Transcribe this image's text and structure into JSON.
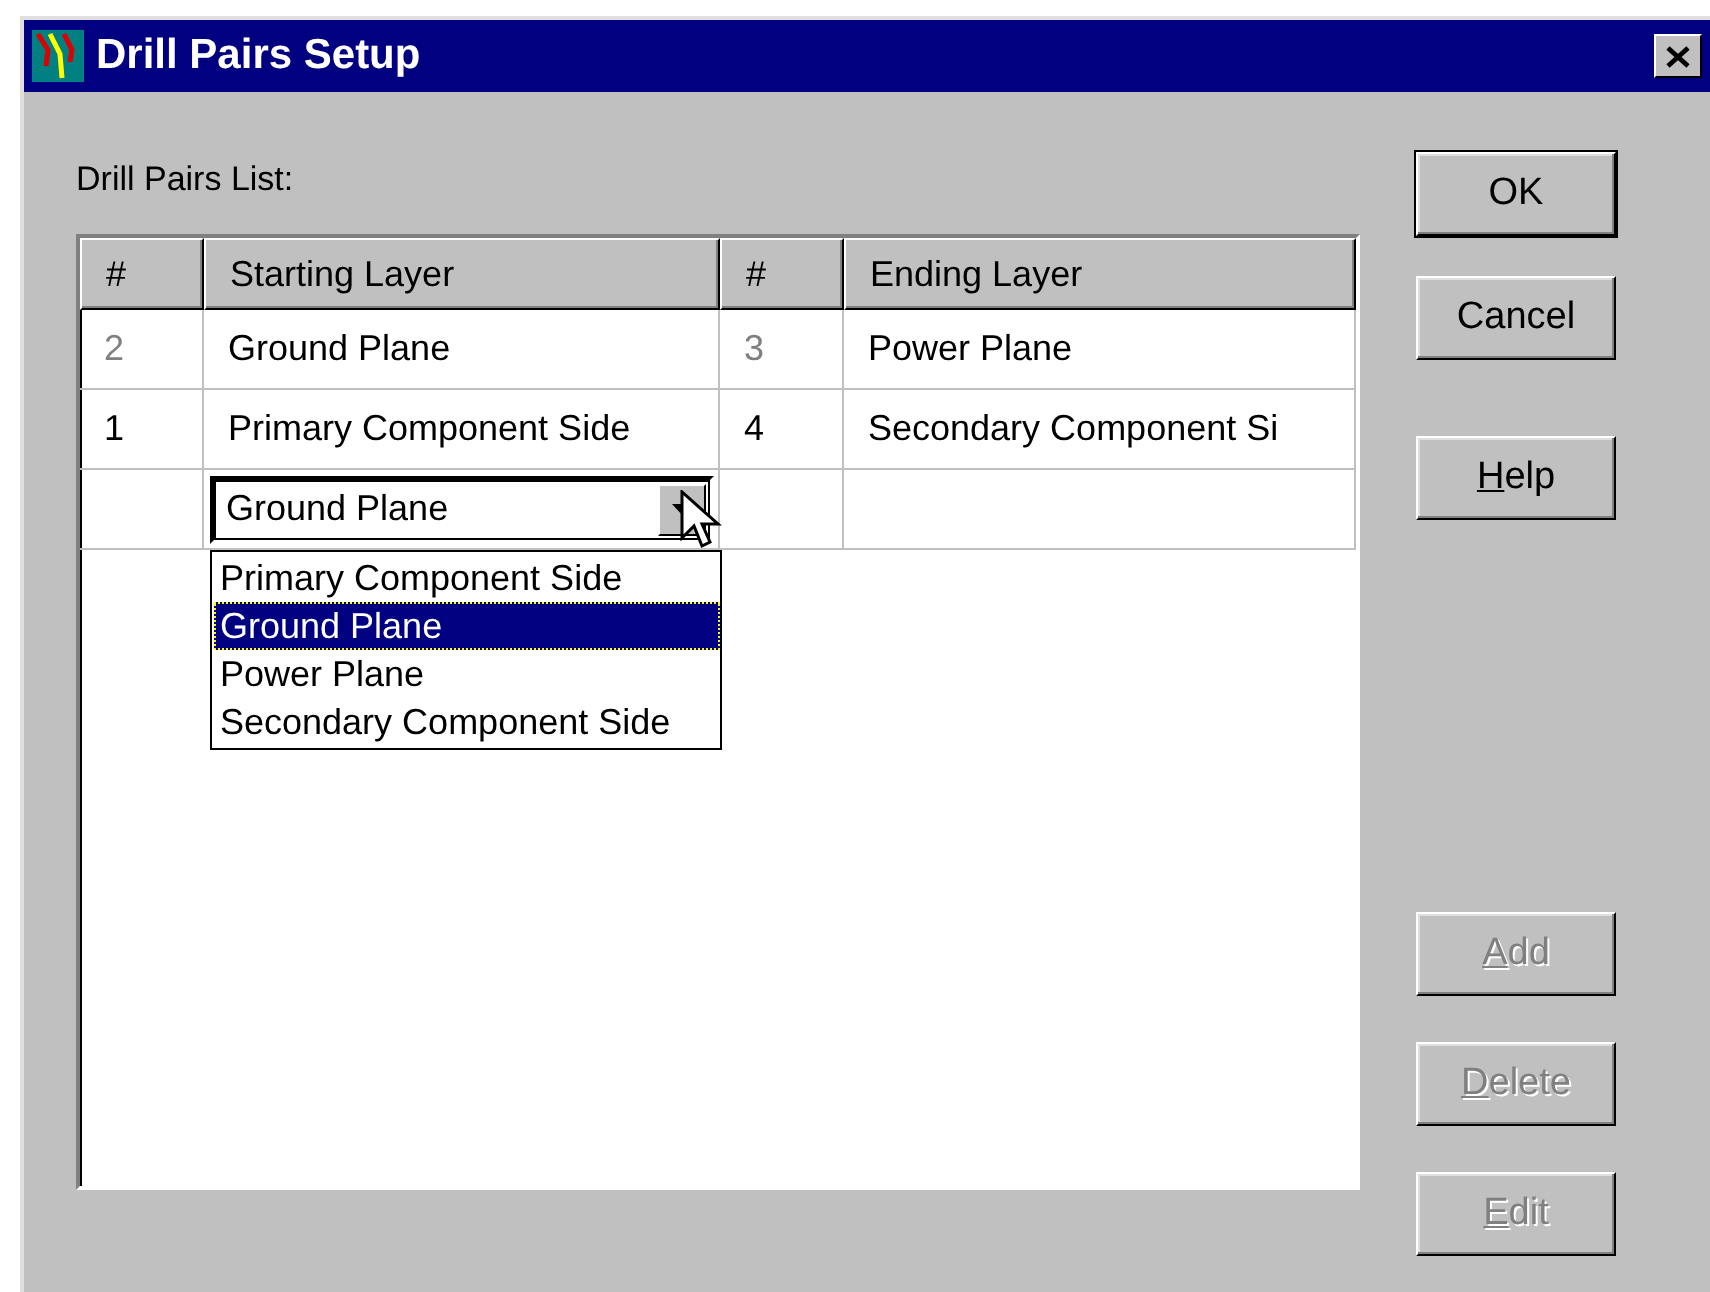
{
  "window": {
    "title": "Drill Pairs Setup"
  },
  "list_label": "Drill Pairs List:",
  "table": {
    "columns": [
      "#",
      "Starting Layer",
      "#",
      "Ending Layer"
    ],
    "rows": [
      {
        "start_no": "2",
        "start_layer": "Ground Plane",
        "end_no": "3",
        "end_layer": "Power Plane",
        "dimmed": true
      },
      {
        "start_no": "1",
        "start_layer": "Primary Component Side",
        "end_no": "4",
        "end_layer": "Secondary Component Si",
        "dimmed": false
      }
    ],
    "editor": {
      "value": "Ground Plane",
      "expanded": true,
      "options": [
        {
          "label": "Primary Component Side",
          "selected": false
        },
        {
          "label": "Ground Plane",
          "selected": true
        },
        {
          "label": "Power Plane",
          "selected": false
        },
        {
          "label": "Secondary Component Side",
          "selected": false
        }
      ]
    }
  },
  "buttons": [
    {
      "kind": "default",
      "label": "OK",
      "disabled": false
    },
    {
      "kind": "normal",
      "label": "Cancel",
      "disabled": false
    },
    {
      "kind": "normal",
      "underlined": "H",
      "label": "elp",
      "disabled": false
    },
    {
      "kind": "gap"
    },
    {
      "kind": "normal",
      "underlined": "A",
      "label": "dd",
      "disabled": true
    },
    {
      "kind": "normal",
      "underlined": "D",
      "label": "elete",
      "disabled": true
    },
    {
      "kind": "normal",
      "underlined": "E",
      "label": "dit",
      "disabled": true
    }
  ]
}
